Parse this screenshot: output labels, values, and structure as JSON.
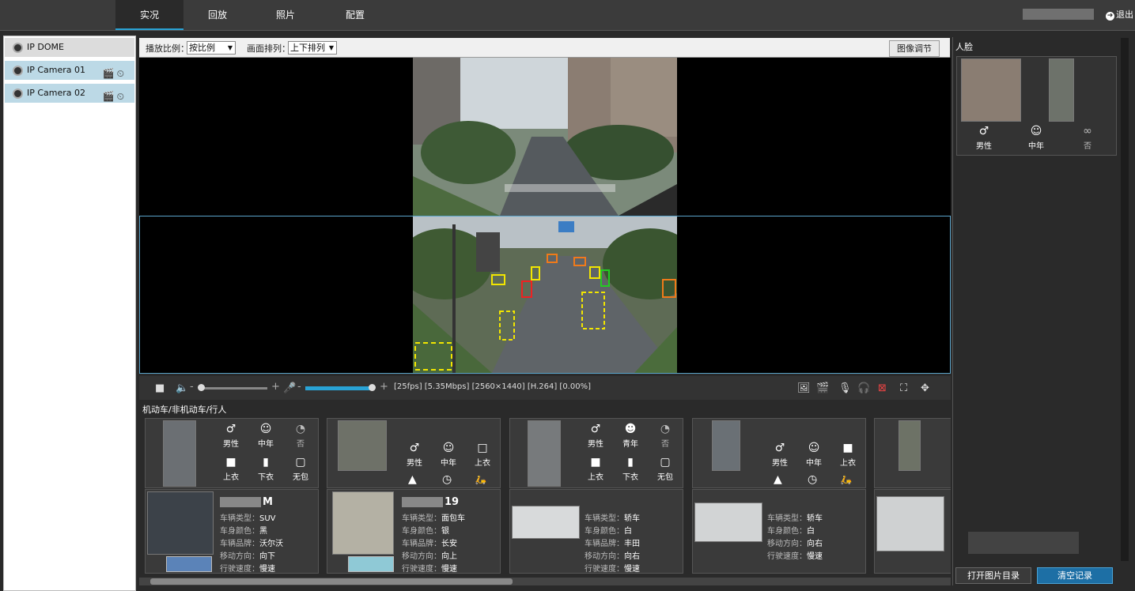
{
  "nav": {
    "tabs": [
      "实况",
      "回放",
      "照片",
      "配置"
    ],
    "active_tab": "实况",
    "logout": "退出"
  },
  "devices": [
    {
      "label": "IP DOME"
    },
    {
      "label": "IP Camera 01"
    },
    {
      "label": "IP Camera 02"
    }
  ],
  "toolbar": {
    "ratio_label": "播放比例：",
    "ratio_value": "按比例",
    "layout_label": "画面排列：",
    "layout_value": "上下排列",
    "image_adjust": "图像调节"
  },
  "stream": {
    "info": "[25fps] [5.35Mbps] [2560×1440] [H.264] [0.00%]",
    "volume_level": 0.0,
    "mic_level": 1.0
  },
  "results": {
    "title": "机动车/非机动车/行人",
    "persons": [
      {
        "gender": "男性",
        "age": "中年",
        "glasses": "否",
        "top": "上衣",
        "bottom": "下衣",
        "bag": "无包"
      },
      {
        "gender": "男性",
        "age": "中年",
        "top": "上衣"
      },
      {
        "gender": "男性",
        "age": "青年",
        "glasses": "否",
        "top": "上衣",
        "bottom": "下衣",
        "bag": "无包"
      },
      {
        "gender": "男性",
        "age": "中年",
        "top": "上衣"
      }
    ],
    "vehicles": [
      {
        "plate_suffix": "M",
        "rows": [
          [
            "车辆类型：",
            "SUV"
          ],
          [
            "车身颜色：",
            "黑"
          ],
          [
            "车辆品牌：",
            "沃尔沃"
          ],
          [
            "移动方向：",
            "向下"
          ],
          [
            "行驶速度：",
            "慢速"
          ]
        ]
      },
      {
        "plate_suffix": "19",
        "rows": [
          [
            "车辆类型：",
            "面包车"
          ],
          [
            "车身颜色：",
            "银"
          ],
          [
            "车辆品牌：",
            "长安"
          ],
          [
            "移动方向：",
            "向上"
          ],
          [
            "行驶速度：",
            "慢速"
          ]
        ]
      },
      {
        "plate_suffix": "",
        "rows": [
          [
            "车辆类型：",
            "轿车"
          ],
          [
            "车身颜色：",
            "白"
          ],
          [
            "车辆品牌：",
            "丰田"
          ],
          [
            "移动方向：",
            "向右"
          ],
          [
            "行驶速度：",
            "慢速"
          ]
        ]
      },
      {
        "plate_suffix": "",
        "rows": [
          [
            "车辆类型：",
            "轿车"
          ],
          [
            "车身颜色：",
            "白"
          ],
          [
            "移动方向：",
            "向右"
          ],
          [
            "行驶速度：",
            "慢速"
          ]
        ]
      }
    ]
  },
  "face": {
    "title": "人脸",
    "gender": "男性",
    "age": "中年",
    "glasses": "否"
  },
  "buttons": {
    "open_dir": "打开图片目录",
    "clear_records": "清空记录"
  },
  "colors": {
    "accent": "#29a3d6",
    "selected_row": "#bcd9e6",
    "box_yellow": "#f2e600",
    "box_orange": "#f07a1a",
    "box_red": "#e22",
    "box_green": "#2c2"
  }
}
